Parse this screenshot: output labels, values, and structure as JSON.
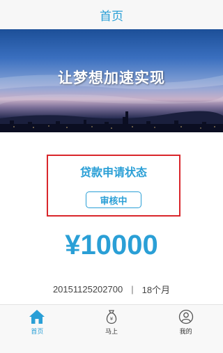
{
  "header": {
    "title": "首页"
  },
  "banner": {
    "slogan": "让梦想加速实现"
  },
  "loan": {
    "status_title": "贷款申请状态",
    "status_value": "审核中",
    "amount": "¥10000",
    "application_no": "20151125202700",
    "separator": "|",
    "term": "18个月"
  },
  "tabbar": {
    "items": [
      {
        "label": "首页",
        "icon": "home-icon",
        "active": true
      },
      {
        "label": "马上",
        "icon": "money-bag-icon",
        "active": false
      },
      {
        "label": "我的",
        "icon": "user-icon",
        "active": false
      }
    ]
  },
  "colors": {
    "accent": "#2a9fd6",
    "highlight_border": "#d9262b",
    "text": "#444444"
  }
}
